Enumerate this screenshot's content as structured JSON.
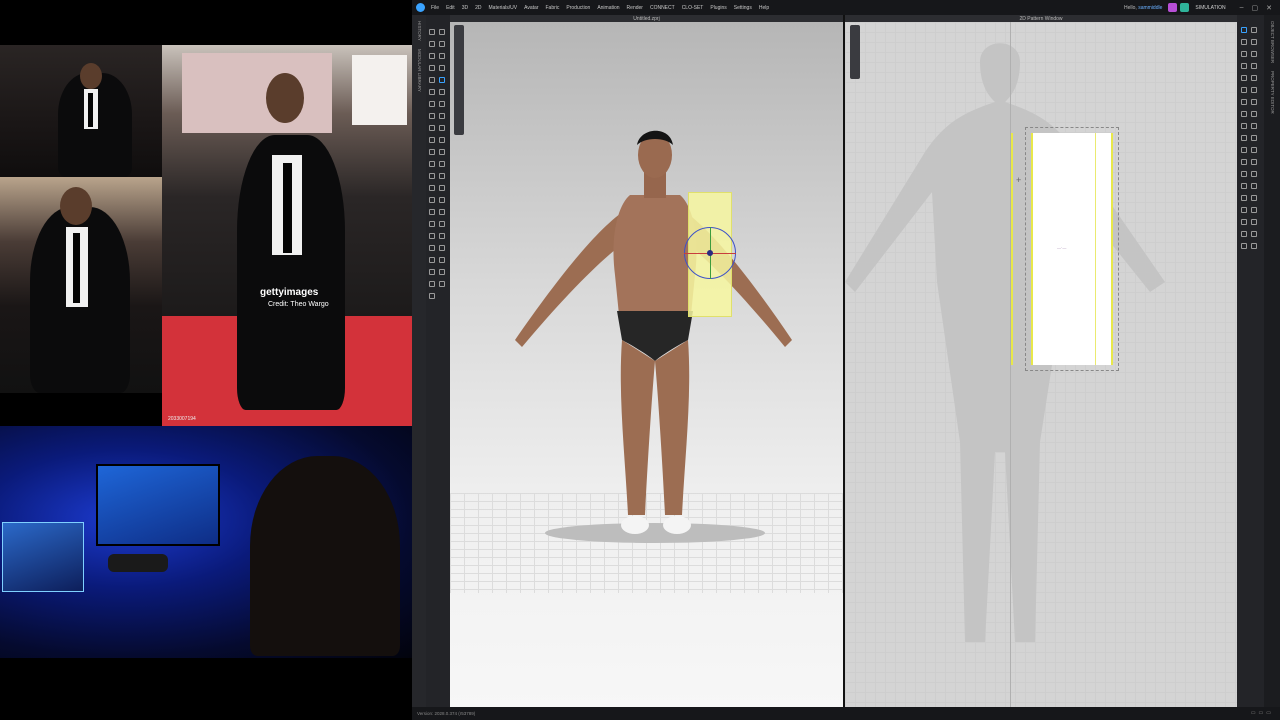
{
  "reference": {
    "getty_logo": "gettyimages",
    "getty_credit": "Credit: Theo Wargo",
    "getty_id": "2033007194"
  },
  "menu": {
    "items": [
      "File",
      "Edit",
      "3D",
      "2D",
      "Materials/UV",
      "Avatar",
      "Fabric",
      "Production",
      "Animation",
      "Render",
      "CONNECT",
      "CLO-SET",
      "Plugins",
      "Settings",
      "Help"
    ],
    "hello_prefix": "Hello,",
    "username": "sammiddle",
    "mode": "SIMULATION",
    "window_controls": [
      "–",
      "▢",
      "✕"
    ]
  },
  "viewport3d": {
    "title": "Untitled.zprj"
  },
  "viewport2d": {
    "title": "2D Pattern Window",
    "pattern_label": "—·—"
  },
  "left_panels": [
    "HISTORY",
    "MODULAR LIBRARY"
  ],
  "right_panels": [
    "OBJECT BROWSER",
    "PROPERTY EDITOR"
  ],
  "status": {
    "version": "Version: 2028.0.374 (r53789)"
  },
  "colors": {
    "accent": "#3aa3ff",
    "pattern_highlight": "#e8e84a"
  }
}
